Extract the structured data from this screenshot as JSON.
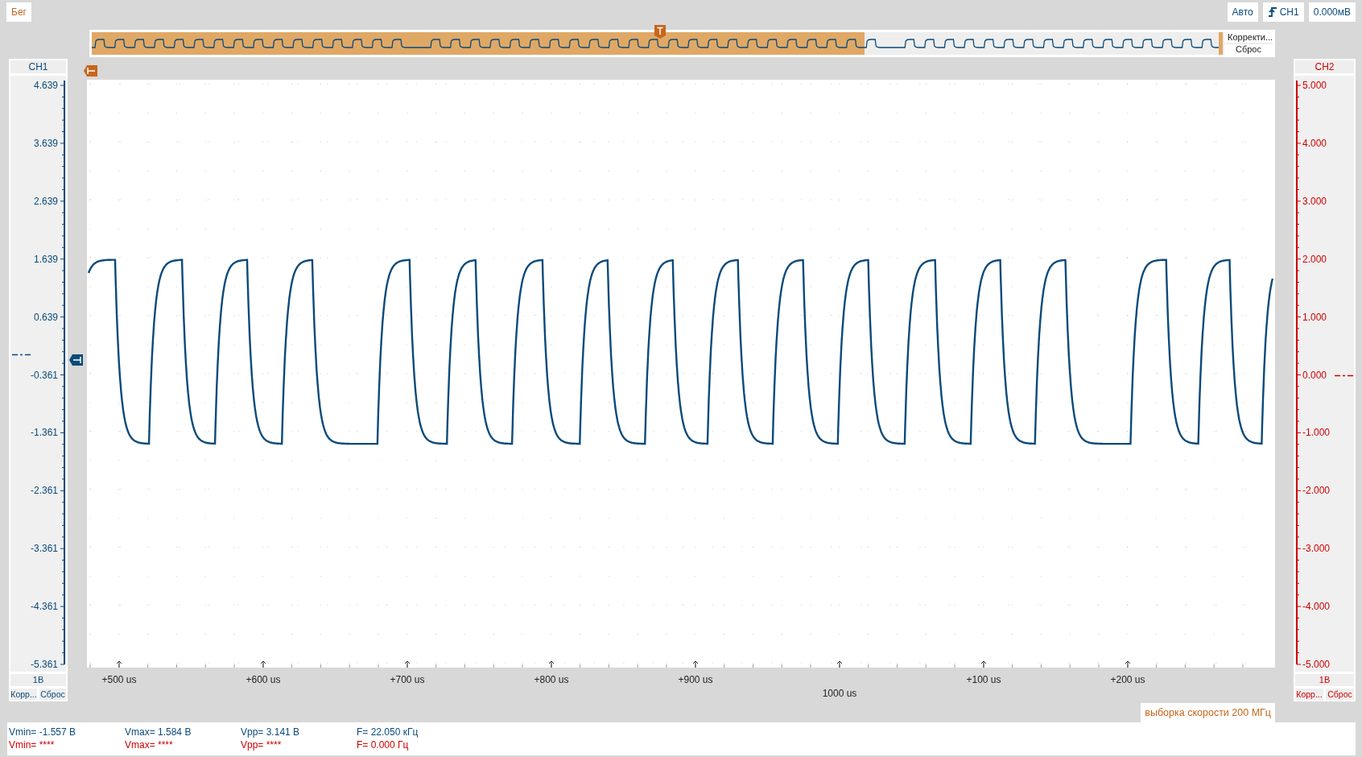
{
  "run_state": "Бег",
  "trigger": {
    "mode": "Авто",
    "channel": "CH1",
    "threshold": "0.000мВ"
  },
  "overview": {
    "buttons": [
      "Корректи...",
      "Сброс"
    ]
  },
  "channels": [
    {
      "name": "CH1",
      "color": "#0b4a7a",
      "ticks": [
        "4.639",
        "3.639",
        "2.639",
        "1.639",
        "0.639",
        "-0.361",
        "-1.361",
        "-2.361",
        "-3.361",
        "-4.361",
        "-5.361"
      ],
      "scale": "1В",
      "buttons": [
        "Корр...",
        "Сброс"
      ]
    },
    {
      "name": "CH2",
      "color": "#cc0000",
      "ticks": [
        "5.000",
        "4.000",
        "3.000",
        "2.000",
        "1.000",
        "0.000",
        "-1.000",
        "-2.000",
        "-3.000",
        "-4.000",
        "-5.000"
      ],
      "scale": "1В",
      "buttons": [
        "Корр...",
        "Сброс"
      ]
    }
  ],
  "x_axis": [
    {
      "text": "+500 us",
      "kind": "major"
    },
    {
      "text": "+600 us",
      "kind": "major"
    },
    {
      "text": "+700 us",
      "kind": "major"
    },
    {
      "text": "+800 us",
      "kind": "major"
    },
    {
      "text": "+900 us",
      "kind": "major"
    },
    {
      "text": "1000 us",
      "kind": "center"
    },
    {
      "text": "+100 us",
      "kind": "major"
    },
    {
      "text": "+200 us",
      "kind": "major"
    }
  ],
  "sample_rate": "выборка скорости 200 МГц",
  "measurements": [
    {
      "color": "#0b4a7a",
      "items": [
        "Vmin= -1.557 В",
        "Vmax= 1.584 В",
        "Vpp= 3.141 В",
        "F= 22.050 кГц"
      ]
    },
    {
      "color": "#cc0000",
      "items": [
        "Vmin= ****",
        "Vmax= ****",
        "Vpp= ****",
        "F= 0.000 Гц"
      ]
    }
  ]
}
